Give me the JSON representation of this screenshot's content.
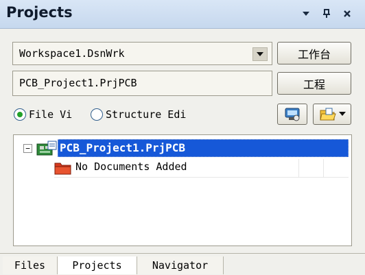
{
  "panel": {
    "title": "Projects"
  },
  "titlebar_controls": {
    "menu_glyph": "▾",
    "pin_glyph": "⊥",
    "close_glyph": "×"
  },
  "workspace": {
    "value": "Workspace1.DsnWrk",
    "button_label": "工作台"
  },
  "project": {
    "value": "PCB_Project1.PrjPCB",
    "button_label": "工程"
  },
  "view_mode": {
    "options": [
      {
        "label": "File Vi",
        "selected": true
      },
      {
        "label": "Structure Edi",
        "selected": false
      }
    ]
  },
  "tree": {
    "expander": "−",
    "project_node": "PCB_Project1.PrjPCB",
    "child_node": "No Documents Added"
  },
  "tabs": [
    "Files",
    "Projects",
    "Navigator"
  ],
  "colors": {
    "selection": "#1658d8",
    "title_bg": "#c6d8ee",
    "folder": "#d63b1f"
  }
}
